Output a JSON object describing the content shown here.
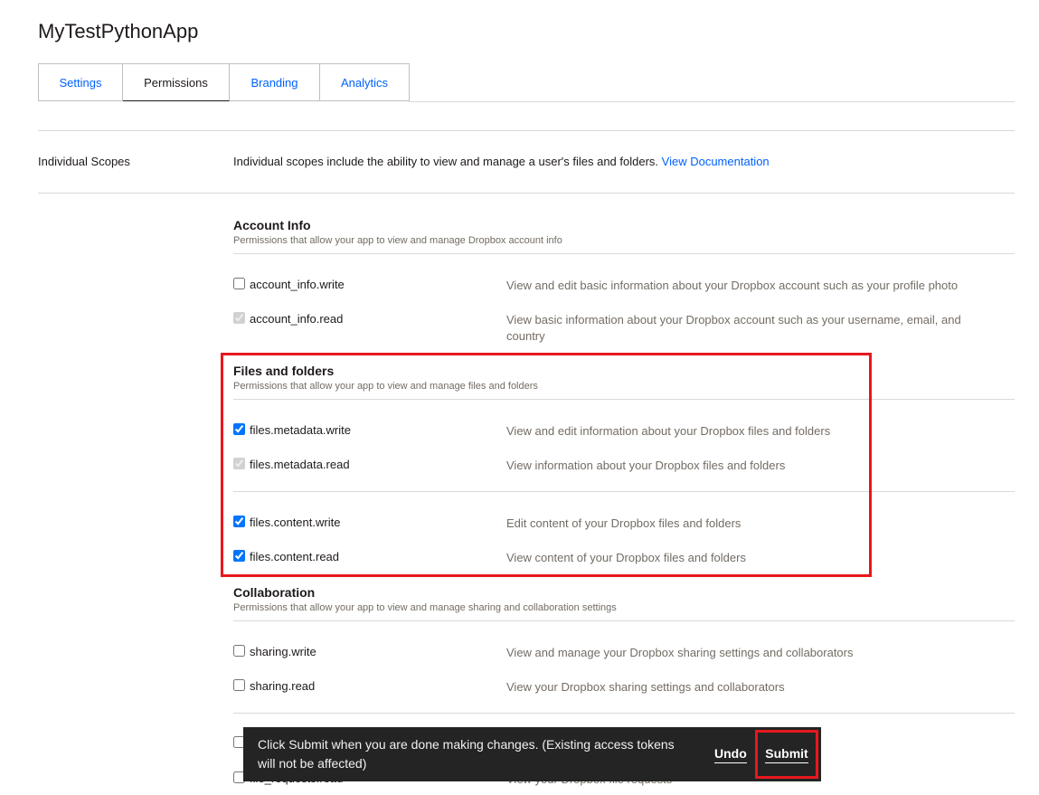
{
  "app": {
    "title": "MyTestPythonApp"
  },
  "tabs": [
    {
      "label": "Settings"
    },
    {
      "label": "Permissions"
    },
    {
      "label": "Branding"
    },
    {
      "label": "Analytics"
    }
  ],
  "scopes": {
    "label": "Individual Scopes",
    "description": "Individual scopes include the ability to view and manage a user's files and folders.",
    "doc_link": "View Documentation"
  },
  "groups": {
    "account": {
      "title": "Account Info",
      "subtitle": "Permissions that allow your app to view and manage Dropbox account info",
      "items": [
        {
          "name": "account_info.write",
          "desc": "View and edit basic information about your Dropbox account such as your profile photo",
          "checked": false,
          "disabled": false
        },
        {
          "name": "account_info.read",
          "desc": "View basic information about your Dropbox account such as your username, email, and country",
          "checked": true,
          "disabled": true
        }
      ]
    },
    "files": {
      "title": "Files and folders",
      "subtitle": "Permissions that allow your app to view and manage files and folders",
      "items": [
        {
          "name": "files.metadata.write",
          "desc": "View and edit information about your Dropbox files and folders",
          "checked": true,
          "disabled": false
        },
        {
          "name": "files.metadata.read",
          "desc": "View information about your Dropbox files and folders",
          "checked": true,
          "disabled": true
        },
        {
          "name": "files.content.write",
          "desc": "Edit content of your Dropbox files and folders",
          "checked": true,
          "disabled": false
        },
        {
          "name": "files.content.read",
          "desc": "View content of your Dropbox files and folders",
          "checked": true,
          "disabled": false
        }
      ]
    },
    "collaboration": {
      "title": "Collaboration",
      "subtitle": "Permissions that allow your app to view and manage sharing and collaboration settings",
      "items": [
        {
          "name": "sharing.write",
          "desc": "View and manage your Dropbox sharing settings and collaborators",
          "checked": false,
          "disabled": false
        },
        {
          "name": "sharing.read",
          "desc": "View your Dropbox sharing settings and collaborators",
          "checked": false,
          "disabled": false
        }
      ]
    },
    "requests": {
      "items": [
        {
          "name": "file_requests.read",
          "desc": "View your Dropbox file requests",
          "checked": false,
          "disabled": false
        }
      ]
    }
  },
  "snackbar": {
    "message": "Click Submit when you are done making changes. (Existing access tokens will not be affected)",
    "undo_label": "Undo",
    "submit_label": "Submit"
  },
  "colors": {
    "accent": "#0061fe",
    "highlight": "#e8171e",
    "snackbar_bg": "#242424"
  }
}
